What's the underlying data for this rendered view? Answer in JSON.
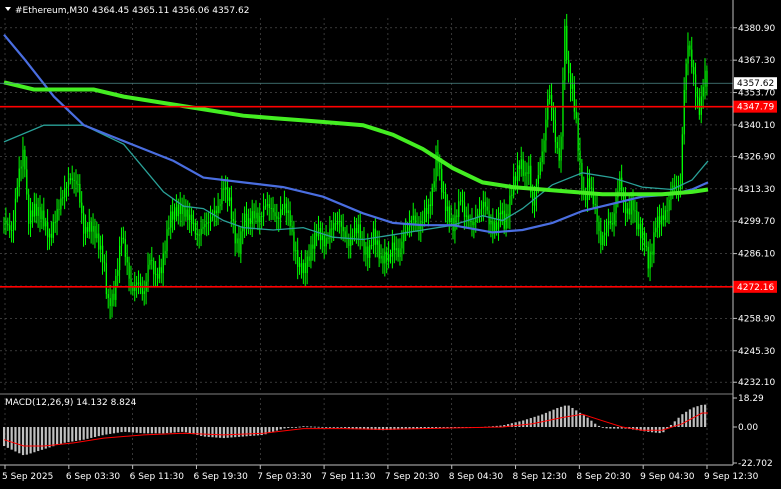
{
  "header": {
    "symbol": "#Ethereum,M30",
    "ohlc": "4364.45 4365.11 4356.06 4357.62"
  },
  "colors": {
    "background": "#000000",
    "grid": "#5a5a5a",
    "candle": "#00ff00",
    "ma_fast": "#2aa198",
    "ma_mid": "#4a6ee0",
    "ma_slow": "#44ee22",
    "level_line": "#ff0000",
    "price_line": "#4d8a8a",
    "macd_hist": "#c0c0c0",
    "macd_signal": "#ff0000",
    "text": "#ffffff"
  },
  "chart_data": [
    {
      "type": "candlestick",
      "title": "#Ethereum,M30",
      "y_ticks": [
        "4380.90",
        "4367.30",
        "4353.70",
        "4340.10",
        "4326.90",
        "4313.30",
        "4299.70",
        "4286.10",
        "4272.50",
        "4258.90",
        "4245.30",
        "4232.10"
      ],
      "ylim": [
        4228.0,
        4385.0
      ],
      "x_ticks": [
        "5 Sep 2025",
        "6 Sep 03:30",
        "6 Sep 11:30",
        "6 Sep 19:30",
        "7 Sep 03:30",
        "7 Sep 11:30",
        "7 Sep 20:30",
        "8 Sep 04:30",
        "8 Sep 12:30",
        "8 Sep 20:30",
        "9 Sep 04:30",
        "9 Sep 12:30"
      ],
      "current_price": "4357.62",
      "levels": [
        {
          "label": "4347.79",
          "value": 4347.79
        },
        {
          "label": "4272.16",
          "value": 4272.16
        }
      ],
      "close_path": [
        [
          0,
          4300
        ],
        [
          8,
          4295
        ],
        [
          14,
          4318
        ],
        [
          20,
          4330
        ],
        [
          24,
          4300
        ],
        [
          30,
          4305
        ],
        [
          38,
          4302
        ],
        [
          46,
          4292
        ],
        [
          52,
          4302
        ],
        [
          60,
          4312
        ],
        [
          66,
          4318
        ],
        [
          74,
          4315
        ],
        [
          80,
          4295
        ],
        [
          86,
          4298
        ],
        [
          92,
          4294
        ],
        [
          100,
          4283
        ],
        [
          104,
          4265
        ],
        [
          110,
          4268
        ],
        [
          114,
          4281
        ],
        [
          118,
          4295
        ],
        [
          124,
          4280
        ],
        [
          128,
          4270
        ],
        [
          134,
          4275
        ],
        [
          140,
          4268
        ],
        [
          146,
          4285
        ],
        [
          152,
          4276
        ],
        [
          158,
          4280
        ],
        [
          166,
          4301
        ],
        [
          170,
          4303
        ],
        [
          176,
          4305
        ],
        [
          182,
          4303
        ],
        [
          188,
          4300
        ],
        [
          194,
          4293
        ],
        [
          200,
          4298
        ],
        [
          206,
          4300
        ],
        [
          210,
          4303
        ],
        [
          215,
          4305
        ],
        [
          220,
          4315
        ],
        [
          226,
          4308
        ],
        [
          232,
          4292
        ],
        [
          236,
          4288
        ],
        [
          240,
          4302
        ],
        [
          244,
          4298
        ],
        [
          250,
          4303
        ],
        [
          256,
          4300
        ],
        [
          262,
          4307
        ],
        [
          268,
          4305
        ],
        [
          274,
          4300
        ],
        [
          280,
          4307
        ],
        [
          286,
          4302
        ],
        [
          290,
          4290
        ],
        [
          296,
          4280
        ],
        [
          302,
          4280
        ],
        [
          308,
          4288
        ],
        [
          314,
          4296
        ],
        [
          318,
          4293
        ],
        [
          322,
          4290
        ],
        [
          326,
          4295
        ],
        [
          330,
          4298
        ],
        [
          336,
          4300
        ],
        [
          342,
          4293
        ],
        [
          346,
          4290
        ],
        [
          350,
          4295
        ],
        [
          356,
          4297
        ],
        [
          360,
          4288
        ],
        [
          366,
          4286
        ],
        [
          370,
          4295
        ],
        [
          374,
          4290
        ],
        [
          378,
          4283
        ],
        [
          382,
          4285
        ],
        [
          386,
          4284
        ],
        [
          390,
          4290
        ],
        [
          396,
          4285
        ],
        [
          400,
          4294
        ],
        [
          406,
          4298
        ],
        [
          410,
          4302
        ],
        [
          414,
          4297
        ],
        [
          418,
          4298
        ],
        [
          422,
          4304
        ],
        [
          426,
          4305
        ],
        [
          430,
          4313
        ],
        [
          434,
          4330
        ],
        [
          438,
          4316
        ],
        [
          442,
          4307
        ],
        [
          446,
          4302
        ],
        [
          450,
          4297
        ],
        [
          454,
          4303
        ],
        [
          458,
          4310
        ],
        [
          462,
          4302
        ],
        [
          466,
          4300
        ],
        [
          470,
          4298
        ],
        [
          474,
          4302
        ],
        [
          478,
          4305
        ],
        [
          482,
          4308
        ],
        [
          486,
          4300
        ],
        [
          490,
          4297
        ],
        [
          494,
          4298
        ],
        [
          498,
          4305
        ],
        [
          502,
          4298
        ],
        [
          506,
          4305
        ],
        [
          510,
          4315
        ],
        [
          514,
          4320
        ],
        [
          518,
          4325
        ],
        [
          522,
          4318
        ],
        [
          526,
          4323
        ],
        [
          530,
          4305
        ],
        [
          534,
          4315
        ],
        [
          538,
          4325
        ],
        [
          542,
          4335
        ],
        [
          546,
          4355
        ],
        [
          550,
          4345
        ],
        [
          554,
          4330
        ],
        [
          558,
          4325
        ],
        [
          562,
          4382
        ],
        [
          566,
          4360
        ],
        [
          570,
          4355
        ],
        [
          574,
          4340
        ],
        [
          578,
          4320
        ],
        [
          582,
          4307
        ],
        [
          586,
          4318
        ],
        [
          590,
          4310
        ],
        [
          594,
          4303
        ],
        [
          598,
          4290
        ],
        [
          602,
          4295
        ],
        [
          606,
          4300
        ],
        [
          610,
          4298
        ],
        [
          614,
          4310
        ],
        [
          618,
          4318
        ],
        [
          622,
          4305
        ],
        [
          626,
          4303
        ],
        [
          630,
          4308
        ],
        [
          634,
          4299
        ],
        [
          638,
          4295
        ],
        [
          642,
          4292
        ],
        [
          646,
          4282
        ],
        [
          650,
          4288
        ],
        [
          654,
          4300
        ],
        [
          658,
          4300
        ],
        [
          662,
          4302
        ],
        [
          666,
          4306
        ],
        [
          670,
          4314
        ],
        [
          674,
          4315
        ],
        [
          678,
          4312
        ],
        [
          682,
          4355
        ],
        [
          686,
          4375
        ],
        [
          690,
          4365
        ],
        [
          694,
          4352
        ],
        [
          698,
          4345
        ],
        [
          702,
          4362
        ],
        [
          706,
          4357
        ]
      ],
      "ma_fast": [
        [
          0,
          4333
        ],
        [
          40,
          4340
        ],
        [
          80,
          4340
        ],
        [
          120,
          4332
        ],
        [
          140,
          4322
        ],
        [
          160,
          4312
        ],
        [
          180,
          4306
        ],
        [
          200,
          4305
        ],
        [
          220,
          4300
        ],
        [
          240,
          4297
        ],
        [
          270,
          4296
        ],
        [
          300,
          4297
        ],
        [
          330,
          4293
        ],
        [
          360,
          4292
        ],
        [
          390,
          4294
        ],
        [
          420,
          4296
        ],
        [
          450,
          4298
        ],
        [
          480,
          4302
        ],
        [
          500,
          4300
        ],
        [
          520,
          4305
        ],
        [
          550,
          4315
        ],
        [
          580,
          4320
        ],
        [
          610,
          4318
        ],
        [
          640,
          4314
        ],
        [
          670,
          4313
        ],
        [
          690,
          4317
        ],
        [
          706,
          4325
        ]
      ],
      "ma_mid": [
        [
          0,
          4378
        ],
        [
          20,
          4368
        ],
        [
          50,
          4352
        ],
        [
          80,
          4340
        ],
        [
          110,
          4335
        ],
        [
          140,
          4330
        ],
        [
          170,
          4325
        ],
        [
          200,
          4318
        ],
        [
          240,
          4316
        ],
        [
          280,
          4314
        ],
        [
          320,
          4310
        ],
        [
          360,
          4303
        ],
        [
          390,
          4299
        ],
        [
          420,
          4298
        ],
        [
          450,
          4298
        ],
        [
          490,
          4295
        ],
        [
          520,
          4296
        ],
        [
          550,
          4299
        ],
        [
          580,
          4304
        ],
        [
          610,
          4307
        ],
        [
          640,
          4310
        ],
        [
          670,
          4311
        ],
        [
          690,
          4313
        ],
        [
          706,
          4316
        ]
      ],
      "ma_slow": [
        [
          0,
          4358
        ],
        [
          30,
          4355
        ],
        [
          60,
          4355
        ],
        [
          90,
          4355
        ],
        [
          120,
          4352
        ],
        [
          150,
          4350
        ],
        [
          180,
          4348
        ],
        [
          210,
          4346
        ],
        [
          240,
          4344
        ],
        [
          270,
          4343
        ],
        [
          300,
          4342
        ],
        [
          330,
          4341
        ],
        [
          360,
          4340
        ],
        [
          390,
          4336
        ],
        [
          420,
          4330
        ],
        [
          450,
          4322
        ],
        [
          480,
          4316
        ],
        [
          510,
          4314
        ],
        [
          540,
          4313
        ],
        [
          570,
          4312
        ],
        [
          600,
          4311
        ],
        [
          630,
          4311
        ],
        [
          660,
          4311
        ],
        [
          690,
          4312
        ],
        [
          706,
          4313
        ]
      ]
    },
    {
      "type": "histogram",
      "title": "MACD(12,26,9) 14.132 8.824",
      "y_ticks": [
        "18.29",
        "0.00",
        "-22.702"
      ],
      "ylim": [
        -22.702,
        18.29
      ],
      "hist_path": [
        [
          0,
          -12
        ],
        [
          20,
          -18
        ],
        [
          40,
          -14
        ],
        [
          60,
          -10
        ],
        [
          80,
          -8
        ],
        [
          100,
          -5
        ],
        [
          120,
          -3
        ],
        [
          140,
          -4
        ],
        [
          160,
          -4
        ],
        [
          180,
          -3
        ],
        [
          200,
          -6
        ],
        [
          220,
          -7
        ],
        [
          240,
          -6
        ],
        [
          260,
          -5
        ],
        [
          280,
          -1
        ],
        [
          300,
          0.5
        ],
        [
          320,
          0
        ],
        [
          340,
          -0.5
        ],
        [
          360,
          -1.5
        ],
        [
          380,
          -2
        ],
        [
          400,
          -1.5
        ],
        [
          420,
          -1
        ],
        [
          440,
          -0.5
        ],
        [
          460,
          -0.5
        ],
        [
          480,
          0
        ],
        [
          500,
          1
        ],
        [
          520,
          4
        ],
        [
          540,
          8
        ],
        [
          555,
          12
        ],
        [
          565,
          14
        ],
        [
          575,
          10
        ],
        [
          585,
          6
        ],
        [
          595,
          1
        ],
        [
          605,
          -1
        ],
        [
          625,
          -1
        ],
        [
          645,
          -3
        ],
        [
          660,
          -4
        ],
        [
          670,
          2
        ],
        [
          680,
          8
        ],
        [
          690,
          12
        ],
        [
          700,
          14.1
        ],
        [
          706,
          14.1
        ]
      ],
      "signal_path": [
        [
          0,
          -8
        ],
        [
          20,
          -12
        ],
        [
          40,
          -12
        ],
        [
          70,
          -10
        ],
        [
          100,
          -7
        ],
        [
          140,
          -5
        ],
        [
          180,
          -4
        ],
        [
          220,
          -5
        ],
        [
          260,
          -4
        ],
        [
          300,
          -1
        ],
        [
          340,
          -1
        ],
        [
          380,
          -1.5
        ],
        [
          420,
          -1
        ],
        [
          460,
          -0.5
        ],
        [
          500,
          0
        ],
        [
          530,
          2
        ],
        [
          560,
          6
        ],
        [
          580,
          8
        ],
        [
          600,
          4
        ],
        [
          620,
          0
        ],
        [
          640,
          -2
        ],
        [
          660,
          -2
        ],
        [
          680,
          2
        ],
        [
          700,
          8.8
        ],
        [
          706,
          8.8
        ]
      ]
    }
  ]
}
